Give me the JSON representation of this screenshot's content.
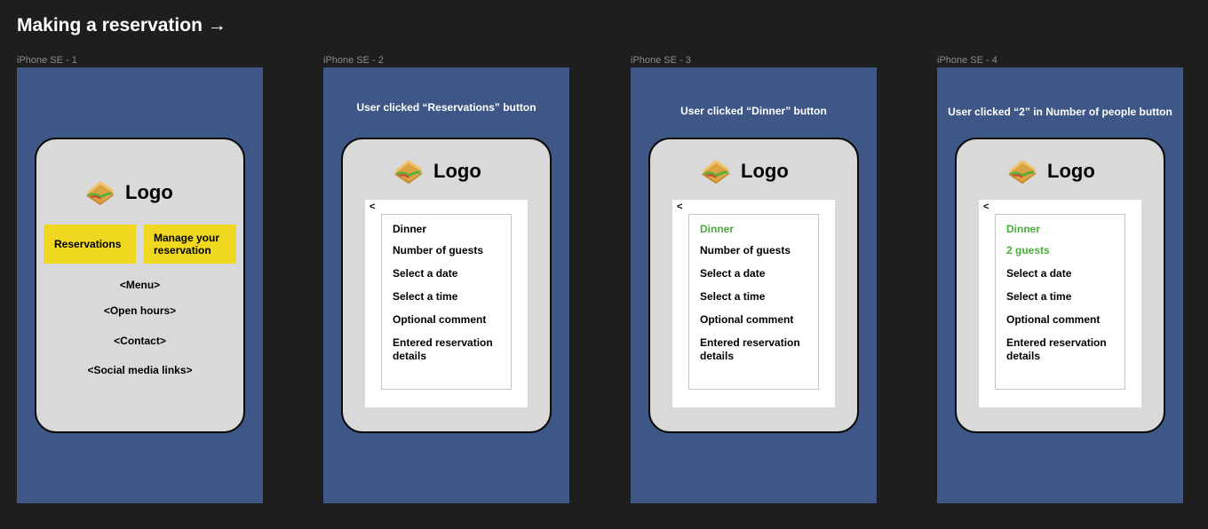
{
  "page": {
    "title": "Making a reservation →"
  },
  "colors": {
    "canvas": "#1e1e1e",
    "frame": "#3e5787",
    "phone": "#d9d9d9",
    "button_yellow": "#f0d821",
    "selected_green": "#4caa3e"
  },
  "frame1": {
    "label": "iPhone SE - 1",
    "logo_icon": "sandwich-icon",
    "logo": "Logo",
    "reservations_button": "Reservations",
    "manage_button_line1": "Manage your",
    "manage_button_line2": "reservation",
    "menu_link": "<Menu>",
    "hours_link": "<Open hours>",
    "contact_link": "<Contact>",
    "social_link": "<Social media links>"
  },
  "frame2": {
    "label": "iPhone SE - 2",
    "caption": "User clicked “Reservations” button",
    "logo": "Logo",
    "back": "<",
    "options": [
      "Dinner",
      "Number of guests",
      "Select a date",
      "Select a time",
      "Optional comment",
      "Entered reservation",
      "details"
    ]
  },
  "frame3": {
    "label": "iPhone SE - 3",
    "caption": "User clicked “Dinner” button",
    "logo": "Logo",
    "back": "<",
    "options": [
      "Dinner",
      "Number of guests",
      "Select a date",
      "Select a time",
      "Optional comment",
      "Entered reservation",
      "details"
    ]
  },
  "frame4": {
    "label": "iPhone SE - 4",
    "caption": "User clicked “2” in Number of people button",
    "logo": "Logo",
    "back": "<",
    "options": [
      "Dinner",
      "2 guests",
      "Select a date",
      "Select a time",
      "Optional comment",
      "Entered reservation",
      "details"
    ]
  }
}
